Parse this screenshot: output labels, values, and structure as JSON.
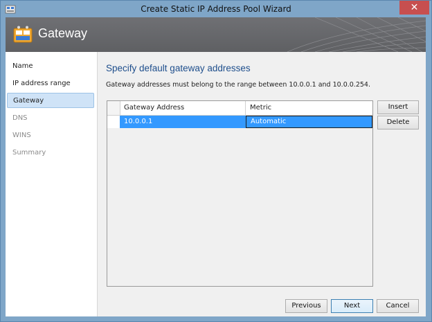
{
  "window": {
    "title": "Create Static IP Address Pool Wizard",
    "close_glyph": "✕"
  },
  "banner": {
    "heading": "Gateway"
  },
  "sidebar": {
    "items": [
      {
        "label": "Name",
        "state": "normal"
      },
      {
        "label": "IP address range",
        "state": "normal"
      },
      {
        "label": "Gateway",
        "state": "active"
      },
      {
        "label": "DNS",
        "state": "disabled"
      },
      {
        "label": "WINS",
        "state": "disabled"
      },
      {
        "label": "Summary",
        "state": "disabled"
      }
    ]
  },
  "main": {
    "title": "Specify default gateway addresses",
    "description": "Gateway addresses must belong to the range between 10.0.0.1 and 10.0.0.254.",
    "grid": {
      "columns": [
        "Gateway Address",
        "Metric"
      ],
      "rows": [
        {
          "address": "10.0.0.1",
          "metric": "Automatic"
        }
      ]
    },
    "side_buttons": {
      "insert": "Insert",
      "delete": "Delete"
    }
  },
  "footer": {
    "previous": "Previous",
    "next": "Next",
    "cancel": "Cancel"
  },
  "colors": {
    "titlebar": "#7fa6c8",
    "close_button": "#c74f4f",
    "selection": "#3399ff",
    "page_title": "#1e4e8c"
  }
}
